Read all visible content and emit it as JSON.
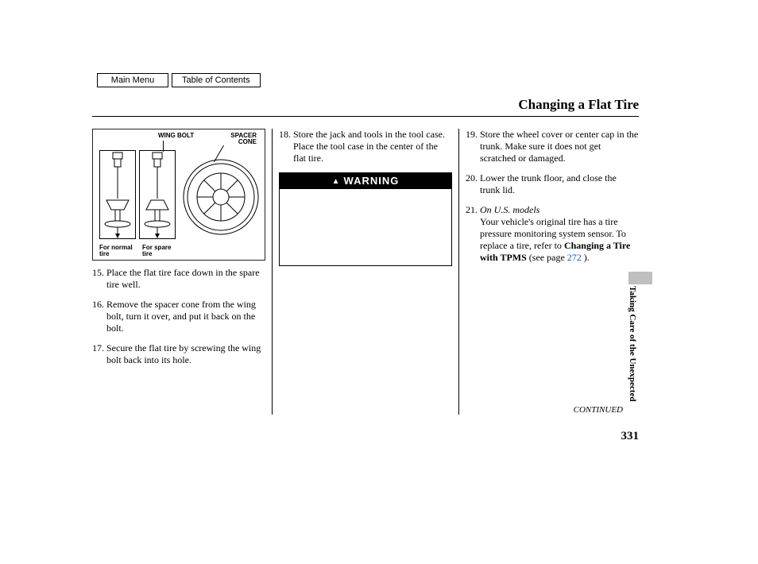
{
  "nav": {
    "main_menu": "Main Menu",
    "toc": "Table of Contents"
  },
  "title": "Changing a Flat Tire",
  "diagram": {
    "wing_bolt": "WING BOLT",
    "spacer_cone": "SPACER\nCONE",
    "for_normal": "For normal\ntire",
    "for_spare": "For spare\ntire"
  },
  "steps": {
    "s15_num": "15.",
    "s15": "Place the flat tire face down in the spare tire well.",
    "s16_num": "16.",
    "s16": "Remove the spacer cone from the wing bolt, turn it over, and put it back on the bolt.",
    "s17_num": "17.",
    "s17": "Secure the flat tire by screwing the wing bolt back into its hole.",
    "s18_num": "18.",
    "s18": "Store the jack and tools in the tool case. Place the tool case in the center of the flat tire.",
    "s19_num": "19.",
    "s19": "Store the wheel cover or center cap in the trunk. Make sure it does not get scratched or damaged.",
    "s20_num": "20.",
    "s20": "Lower the trunk floor, and close the trunk lid.",
    "s21_num": "21.",
    "s21_model": "On U.S. models",
    "s21_a": "Your vehicle's original tire has a tire pressure monitoring system sensor. To replace a tire, refer to ",
    "s21_bold": "Changing a Tire with TPMS",
    "s21_b": " (see page ",
    "s21_link": "272",
    "s21_c": " )."
  },
  "warning_header": "WARNING",
  "continued": "CONTINUED",
  "section": "Taking Care of the Unexpected",
  "page_number": "331"
}
